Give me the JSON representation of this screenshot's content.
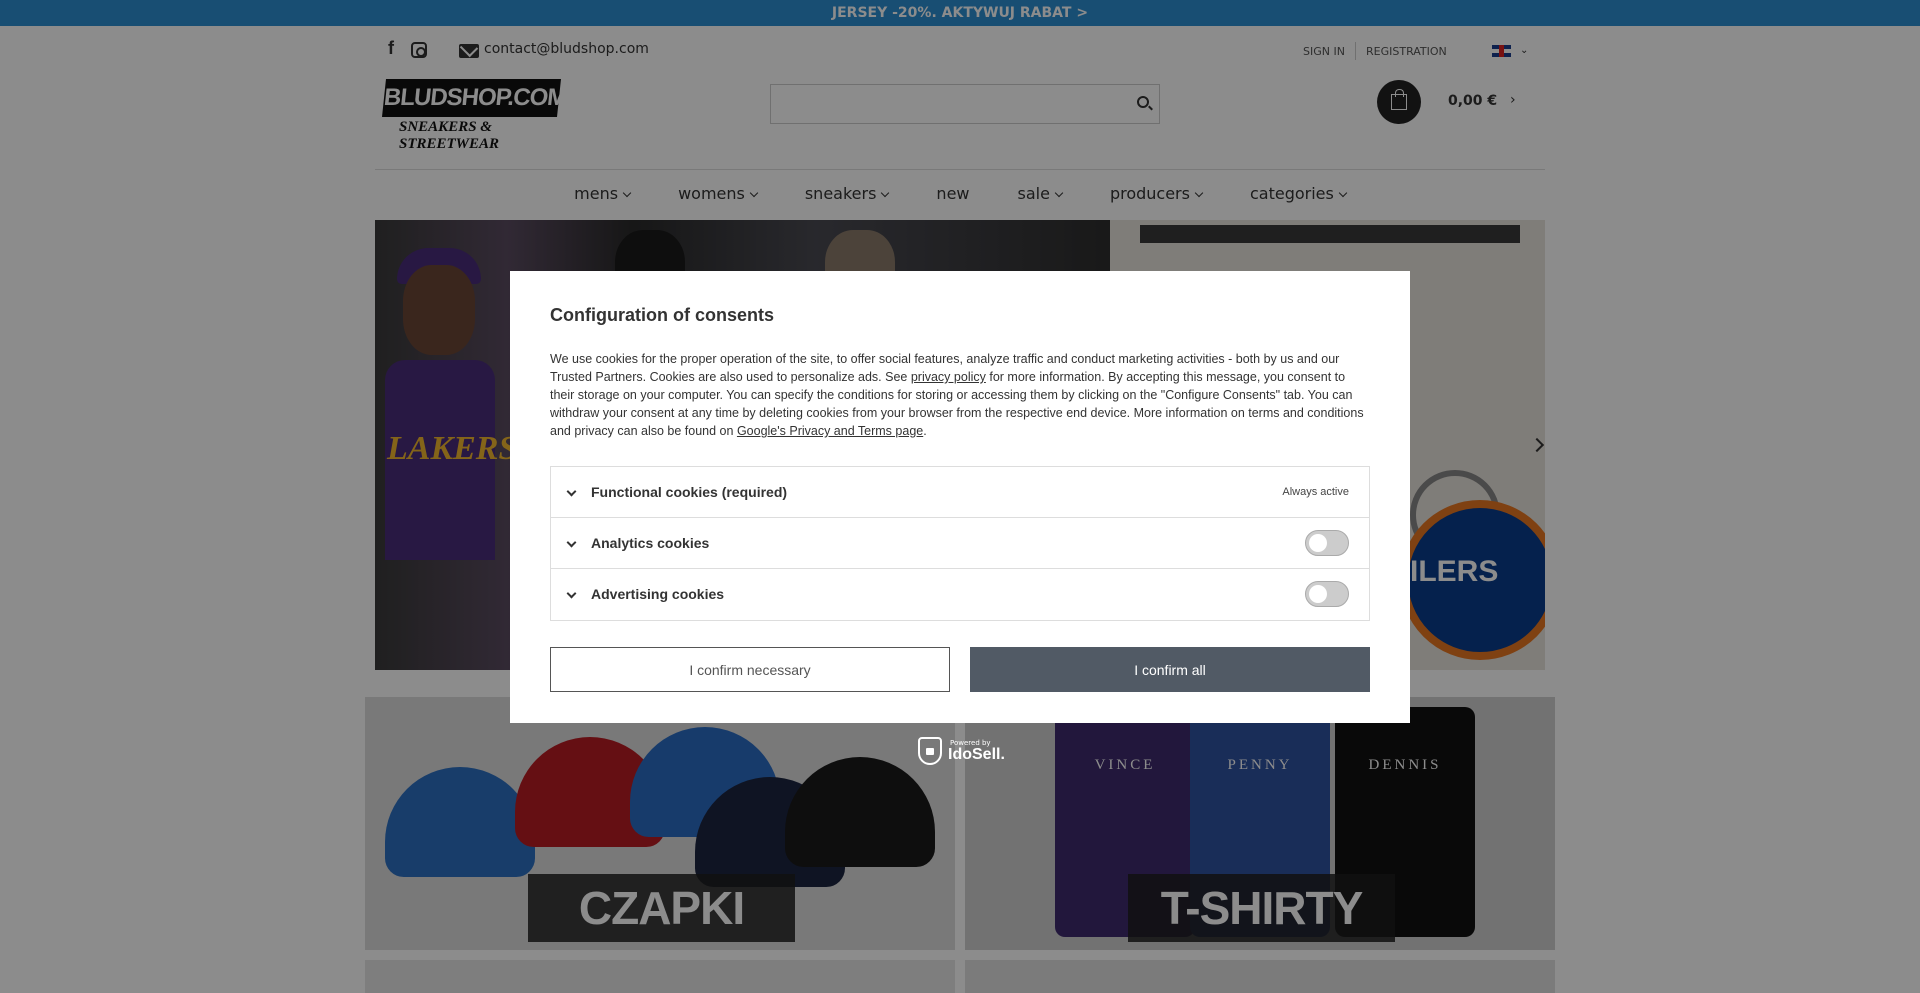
{
  "promo": {
    "text": "JERSEY -20%. AKTYWUJ RABAT >"
  },
  "topbar": {
    "email": "contact@bludshop.com",
    "sign_in": "SIGN IN",
    "registration": "REGISTRATION"
  },
  "header": {
    "logo_main": "BLUDSHOP.COM",
    "logo_sub": "SNEAKERS & STREETWEAR",
    "search_placeholder": "",
    "cart_total": "0,00 €"
  },
  "nav": {
    "items": [
      {
        "label": "mens"
      },
      {
        "label": "womens"
      },
      {
        "label": "sneakers"
      },
      {
        "label": "new"
      },
      {
        "label": "sale"
      },
      {
        "label": "producers"
      },
      {
        "label": "categories"
      }
    ]
  },
  "banner": {
    "left_text": "LAKERS",
    "right_text": "ILERS"
  },
  "tiles": {
    "caps_label": "CZAPKI",
    "shirts_label": "T-SHIRTY",
    "shirt_names": [
      "VINCE",
      "PENNY",
      "DENNIS"
    ]
  },
  "modal": {
    "title": "Configuration of consents",
    "text_part1": "We use cookies for the proper operation of the site, to offer social features, analyze traffic and conduct marketing activities - both by us and our Trusted Partners. Cookies are also used to personalize ads. See ",
    "privacy_link": "privacy policy",
    "text_part2": " for more information. By accepting this message, you consent to their storage on your computer. You can specify the conditions for storing or accessing them by clicking on the \"Configure Consents\" tab. You can withdraw your consent at any time by deleting cookies from your browser from the respective end device. More information on terms and conditions and privacy can also be found on ",
    "google_link": "Google's Privacy and Terms page",
    "text_part3": ".",
    "rows": [
      {
        "label": "Functional cookies (required)",
        "status": "Always active"
      },
      {
        "label": "Analytics cookies",
        "enabled": false
      },
      {
        "label": "Advertising cookies",
        "enabled": false
      }
    ],
    "btn_necessary": "I confirm necessary",
    "btn_all": "I confirm all"
  },
  "powered": {
    "small": "Powered by",
    "brand": "IdoSell."
  }
}
